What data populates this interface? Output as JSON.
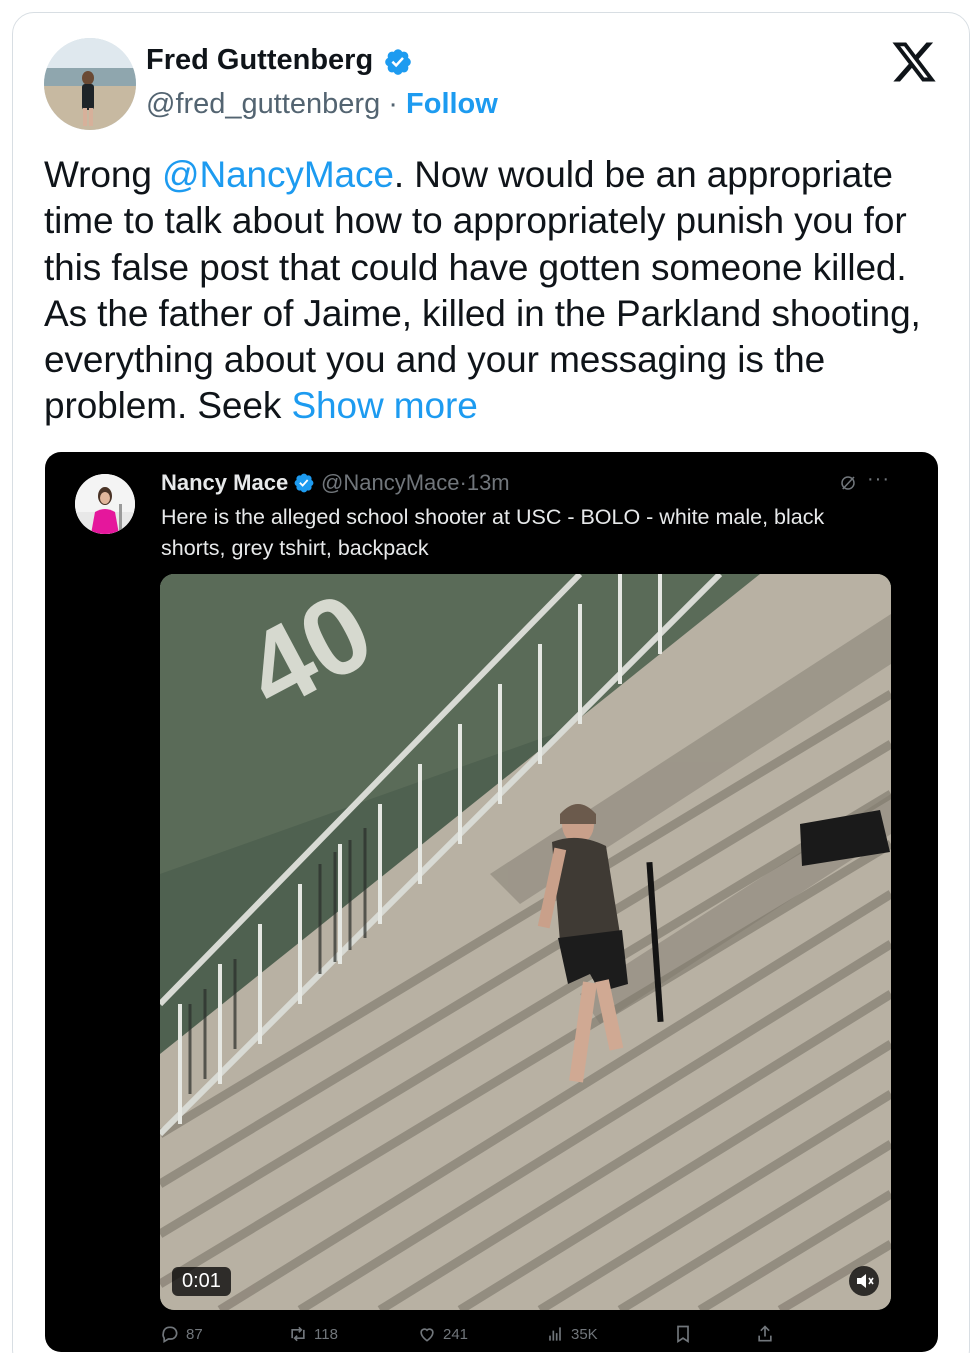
{
  "tweet": {
    "author": {
      "name": "Fred Guttenberg",
      "handle": "@fred_guttenberg",
      "separator": "·",
      "follow_label": "Follow"
    },
    "text_parts": {
      "p1": "Wrong ",
      "mention": "@NancyMace",
      "p2": ".  Now would be an appropriate time to talk about how to appropriately punish you for this false post that could have gotten someone killed. As the father of Jaime, killed in the Parkland shooting, everything about you and your messaging is the problem.  Seek ",
      "show_more": "Show more"
    },
    "icons": {
      "verified": "verified-badge-icon",
      "platform": "x-logo-icon"
    },
    "colors": {
      "accent": "#1d9bf0",
      "text": "#0f1419",
      "secondary": "#536471"
    }
  },
  "quote": {
    "author_name": "Nancy Mace",
    "handle": "@NancyMace",
    "separator": "·",
    "time": "13m",
    "more": "···",
    "body": "Here is the alleged school shooter at USC - BOLO - white male, black shorts, grey tshirt, backpack",
    "video": {
      "timecode": "0:01",
      "overlay_text": "40"
    },
    "actions": {
      "replies": "87",
      "retweets": "118",
      "likes": "241",
      "views": "35K"
    }
  }
}
